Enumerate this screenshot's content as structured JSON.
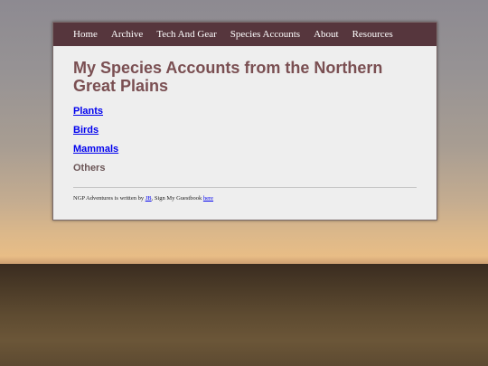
{
  "nav": {
    "items": [
      "Home",
      "Archive",
      "Tech And Gear",
      "Species Accounts",
      "About",
      "Resources"
    ]
  },
  "page": {
    "title": "My Species Accounts from the Northern Great Plains"
  },
  "categories": {
    "plants": "Plants",
    "birds": "Birds",
    "mammals": "Mammals",
    "others": "Others"
  },
  "footer": {
    "prefix": "NGP Adventures is written by ",
    "author": "JB",
    "middle": ", Sign My Guestbook ",
    "link": "here"
  },
  "colors": {
    "nav_bg": "#56363d",
    "title": "#7a4f52",
    "link": "#0000ee"
  }
}
